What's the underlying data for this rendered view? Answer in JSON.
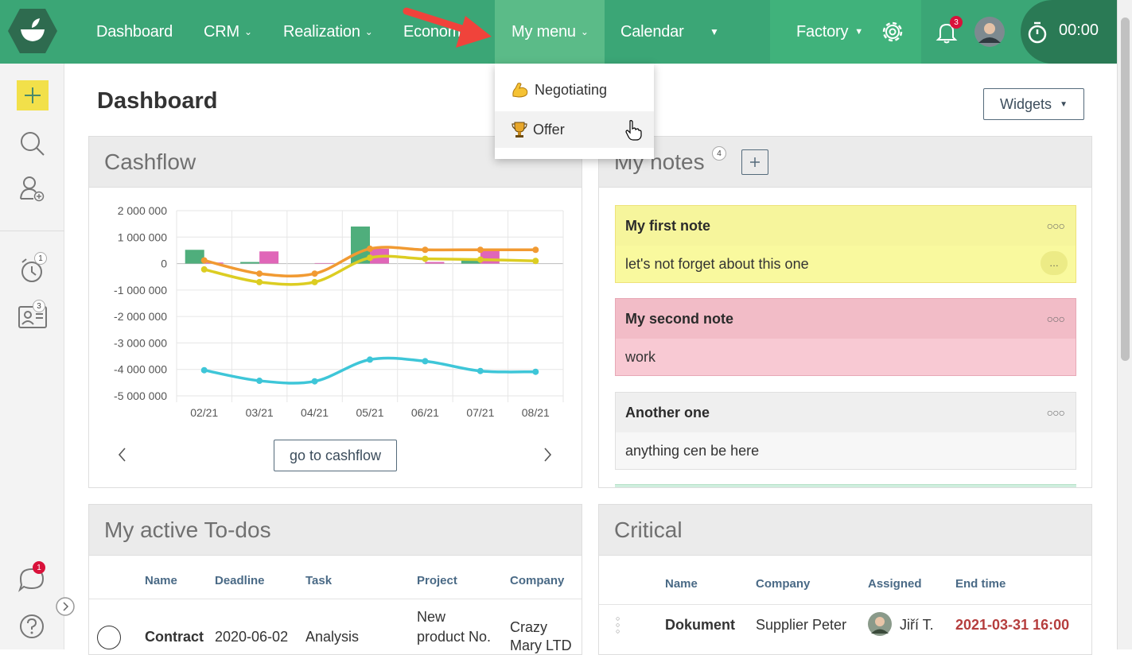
{
  "nav": {
    "items": [
      {
        "label": "Dashboard",
        "dropdown": false
      },
      {
        "label": "CRM",
        "dropdown": true
      },
      {
        "label": "Realization",
        "dropdown": true
      },
      {
        "label": "Econom",
        "dropdown": false
      },
      {
        "label": "My menu",
        "dropdown": true
      },
      {
        "label": "Calendar",
        "dropdown": false
      }
    ],
    "company": "Factory",
    "notifications_count": "3",
    "timer": "00:00"
  },
  "dropdown": {
    "items": [
      {
        "label": "Negotiating",
        "icon": "flexed-biceps-icon"
      },
      {
        "label": "Offer",
        "icon": "trophy-icon"
      }
    ]
  },
  "sidebar": {
    "reminders_count": "1",
    "contacts_count": "3",
    "chat_count": "1"
  },
  "page": {
    "title": "Dashboard",
    "widgets_label": "Widgets"
  },
  "cashflow": {
    "title": "Cashflow",
    "button": "go to cashflow"
  },
  "chart_data": {
    "type": "bar",
    "categories": [
      "02/21",
      "03/21",
      "04/21",
      "05/21",
      "06/21",
      "07/21",
      "08/21"
    ],
    "yticks": [
      "2 000 000",
      "1 000 000",
      "0",
      "-1 000 000",
      "-2 000 000",
      "-3 000 000",
      "-4 000 000",
      "-5 000 000"
    ],
    "ylim": [
      -5000000,
      2000000
    ],
    "series": [
      {
        "kind": "bar",
        "color": "#4fae7c",
        "values": [
          520000,
          60000,
          0,
          1400000,
          0,
          150000,
          0
        ]
      },
      {
        "kind": "bar",
        "color": "#e066b8",
        "values": [
          40000,
          460000,
          20000,
          560000,
          60000,
          520000,
          0
        ]
      },
      {
        "kind": "line",
        "color": "#f19a32",
        "values": [
          120000,
          -380000,
          -380000,
          560000,
          520000,
          520000,
          520000
        ]
      },
      {
        "kind": "line",
        "color": "#dccd22",
        "values": [
          -220000,
          -700000,
          -700000,
          220000,
          180000,
          150000,
          100000
        ]
      },
      {
        "kind": "line",
        "color": "#3ec6d8",
        "values": [
          -4030000,
          -4430000,
          -4450000,
          -3630000,
          -3690000,
          -4060000,
          -4090000
        ]
      }
    ]
  },
  "notes": {
    "title": "My notes",
    "count": "4",
    "items": [
      {
        "title": "My first note",
        "body": "let's not forget about this one",
        "head_color": "#f6f59c",
        "body_color": "#f9f99e"
      },
      {
        "title": "My second note",
        "body": "work",
        "head_color": "#f2bcc7",
        "body_color": "#f8c9d3"
      },
      {
        "title": "Another one",
        "body": "anything cen be here",
        "head_color": "#efefef",
        "body_color": "#f7f7f7"
      }
    ]
  },
  "todos": {
    "title": "My active To-dos",
    "columns": [
      "Name",
      "Deadline",
      "Task",
      "Project",
      "Company"
    ],
    "row": {
      "name": "Contract",
      "deadline": "2020-06-02",
      "task": "Analysis",
      "project_1": "New",
      "project_2": "product No.",
      "company_1": "Crazy",
      "company_2": "Mary LTD"
    }
  },
  "critical": {
    "title": "Critical",
    "columns": [
      "Name",
      "Company",
      "Assigned",
      "End time"
    ],
    "row": {
      "name": "Dokument",
      "company": "Supplier Peter",
      "assigned": "Jiří T.",
      "end_time": "2021-03-31 16:00"
    }
  }
}
